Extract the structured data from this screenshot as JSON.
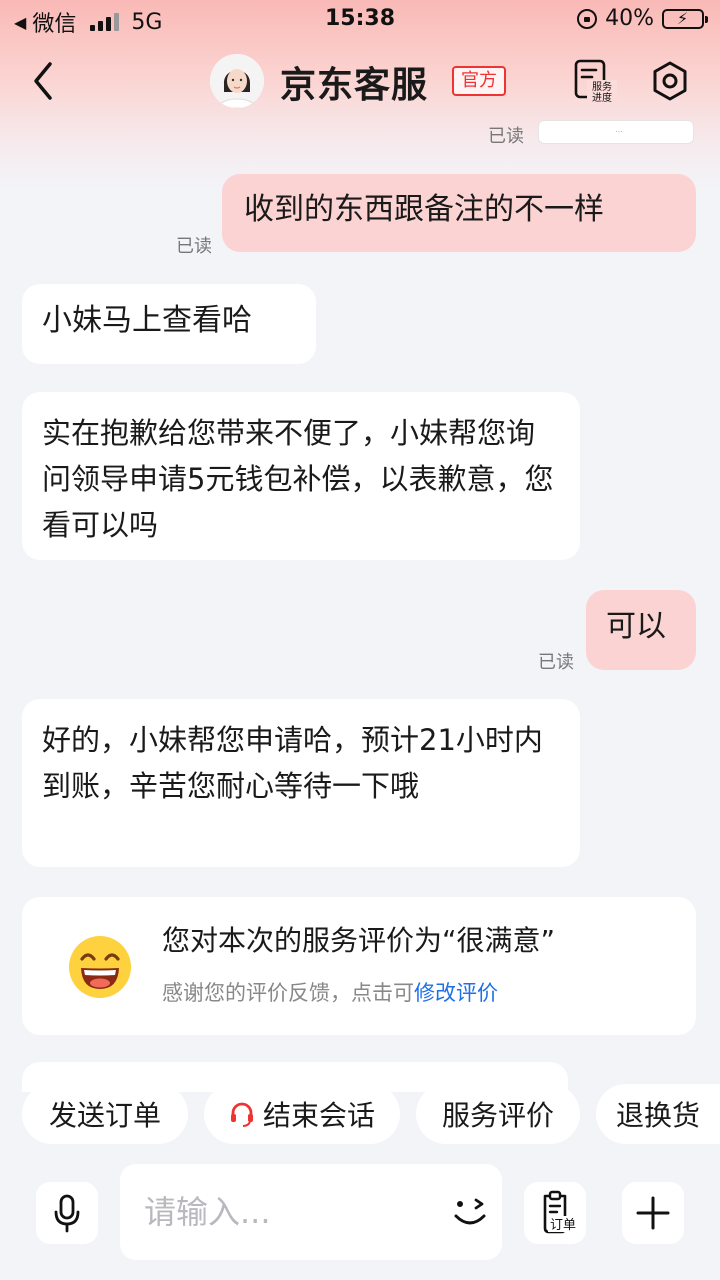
{
  "status_bar": {
    "back_app": "微信",
    "network": "5G",
    "time": "15:38",
    "battery": "40%",
    "battery_level": 0.4
  },
  "header": {
    "title": "京东客服",
    "badge": "官方",
    "progress_line1": "服务",
    "progress_line2": "进度"
  },
  "chat": {
    "read_label": "已读",
    "messages": [
      {
        "from": "me",
        "text": "收到的东西跟备注的不一样",
        "read": "已读"
      },
      {
        "from": "agent",
        "text": "小妹马上查看哈"
      },
      {
        "from": "agent",
        "text": "实在抱歉给您带来不便了，小妹帮您询问领导申请5元钱包补偿，以表歉意，您看可以吗"
      },
      {
        "from": "me",
        "text": "可以",
        "read": "已读"
      },
      {
        "from": "agent",
        "text": "好的，小妹帮您申请哈，预计21小时内到账，辛苦您耐心等待一下哦"
      }
    ]
  },
  "rating": {
    "title": "您对本次的服务评价为“很满意”",
    "subtitle": "感谢您的评价反馈，点击可",
    "link": "修改评价"
  },
  "quick_actions": [
    "发送订单",
    "结束会话",
    "服务评价",
    "退换货"
  ],
  "input": {
    "placeholder": "请输入...",
    "order_label": "订单"
  },
  "colors": {
    "my_bubble": "#fbd3d2",
    "accent_red": "#e33333",
    "link_blue": "#1f6fe8"
  }
}
